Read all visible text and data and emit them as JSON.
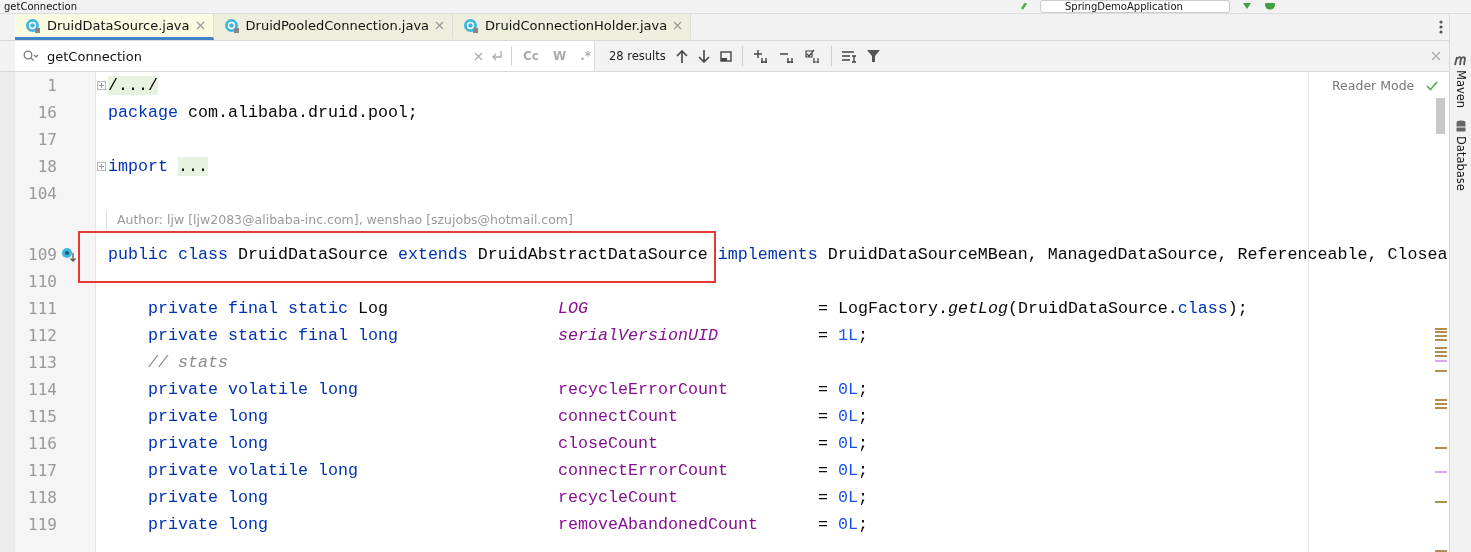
{
  "window": {
    "title": "getConnection",
    "run_config": "SpringDemoApplication"
  },
  "tabs": [
    {
      "label": "DruidDataSource.java",
      "selected": true
    },
    {
      "label": "DruidPooledConnection.java",
      "selected": false
    },
    {
      "label": "DruidConnectionHolder.java",
      "selected": false
    }
  ],
  "search": {
    "value": "getConnection",
    "toggles": [
      "Cc",
      "W",
      ".*"
    ],
    "results": "28 results"
  },
  "reader_mode": "Reader Mode",
  "editor": {
    "rows": [
      {
        "kind": "code",
        "number": "1",
        "folded": true,
        "tokens": [
          {
            "text": "/.../",
            "kind": "fold"
          }
        ]
      },
      {
        "kind": "code",
        "number": "16",
        "tokens": [
          {
            "text": "package",
            "kind": "keyword"
          },
          {
            "text": "com.alibaba.druid.pool;",
            "kind": "plain"
          }
        ]
      },
      {
        "kind": "code",
        "number": "17",
        "tokens": []
      },
      {
        "kind": "code",
        "number": "18",
        "folded": true,
        "tokens": [
          {
            "text": "import",
            "kind": "keyword"
          },
          {
            "text": "...",
            "kind": "fold"
          }
        ]
      },
      {
        "kind": "code",
        "number": "104",
        "tokens": []
      },
      {
        "kind": "inlay",
        "text": "Author: ljw [ljw2083@alibaba-inc.com], wenshao [szujobs@hotmail.com]"
      },
      {
        "kind": "code",
        "number": "109",
        "implemented": true,
        "tokens": [
          {
            "text": "public class",
            "kind": "keyword"
          },
          {
            "text": "DruidDataSource",
            "kind": "plain"
          },
          {
            "text": "extends",
            "kind": "keyword"
          },
          {
            "text": "DruidAbstractDataSource",
            "kind": "plain"
          },
          {
            "text": "implements",
            "kind": "keyword"
          },
          {
            "text": "DruidDataSourceMBean, ManagedDataSource, Referenceable, Closea",
            "kind": "plain"
          }
        ]
      },
      {
        "kind": "code",
        "number": "110",
        "tokens": []
      },
      {
        "kind": "declaration",
        "number": "111",
        "modifiers": "private final static",
        "type": "Log",
        "name": "LOG",
        "static": true,
        "init": [
          {
            "text": "= LogFactory.",
            "kind": "plain"
          },
          {
            "text": "getLog",
            "kind": "static-call"
          },
          {
            "text": "(DruidDataSource.",
            "kind": "plain"
          },
          {
            "text": "class",
            "kind": "keyword"
          },
          {
            "text": ");",
            "kind": "plain"
          }
        ]
      },
      {
        "kind": "declaration",
        "number": "112",
        "modifiers": "private static final long",
        "name": "serialVersionUID",
        "static": true,
        "init": [
          {
            "text": "= ",
            "kind": "plain"
          },
          {
            "text": "1L",
            "kind": "number"
          },
          {
            "text": ";",
            "kind": "plain"
          }
        ]
      },
      {
        "kind": "comment",
        "number": "113",
        "text": "// stats"
      },
      {
        "kind": "declaration",
        "number": "114",
        "modifiers": "private volatile long",
        "name": "recycleErrorCount",
        "static": false,
        "init": [
          {
            "text": "= ",
            "kind": "plain"
          },
          {
            "text": "0L",
            "kind": "number"
          },
          {
            "text": ";",
            "kind": "plain"
          }
        ]
      },
      {
        "kind": "declaration",
        "number": "115",
        "modifiers": "private long",
        "name": "connectCount",
        "static": false,
        "init": [
          {
            "text": "= ",
            "kind": "plain"
          },
          {
            "text": "0L",
            "kind": "number"
          },
          {
            "text": ";",
            "kind": "plain"
          }
        ]
      },
      {
        "kind": "declaration",
        "number": "116",
        "modifiers": "private long",
        "name": "closeCount",
        "static": false,
        "init": [
          {
            "text": "= ",
            "kind": "plain"
          },
          {
            "text": "0L",
            "kind": "number"
          },
          {
            "text": ";",
            "kind": "plain"
          }
        ]
      },
      {
        "kind": "declaration",
        "number": "117",
        "modifiers": "private volatile long",
        "name": "connectErrorCount",
        "static": false,
        "init": [
          {
            "text": "= ",
            "kind": "plain"
          },
          {
            "text": "0L",
            "kind": "number"
          },
          {
            "text": ";",
            "kind": "plain"
          }
        ]
      },
      {
        "kind": "declaration",
        "number": "118",
        "modifiers": "private long",
        "name": "recycleCount",
        "static": false,
        "init": [
          {
            "text": "= ",
            "kind": "plain"
          },
          {
            "text": "0L",
            "kind": "number"
          },
          {
            "text": ";",
            "kind": "plain"
          }
        ]
      },
      {
        "kind": "declaration",
        "number": "119",
        "modifiers": "private long",
        "name": "removeAbandonedCount",
        "static": false,
        "init": [
          {
            "text": "= ",
            "kind": "plain"
          },
          {
            "text": "0L",
            "kind": "number"
          },
          {
            "text": ";",
            "kind": "plain"
          }
        ]
      }
    ]
  },
  "right_stripe": [
    "Maven",
    "Database"
  ]
}
